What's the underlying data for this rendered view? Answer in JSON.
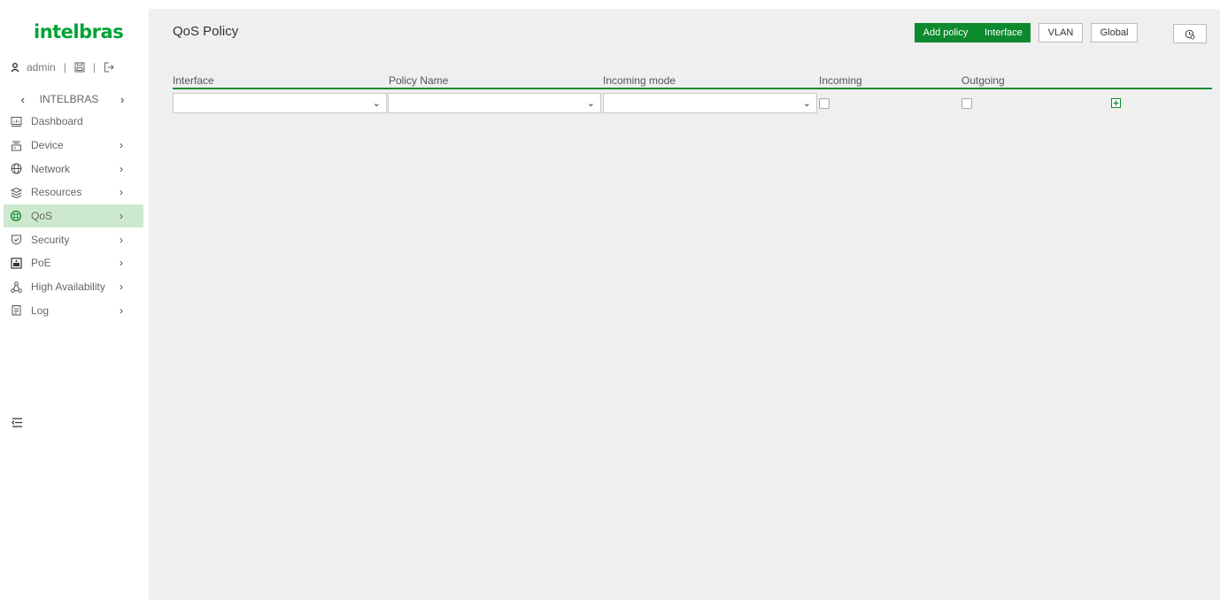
{
  "sidebar": {
    "logo": "intelbras",
    "user": "admin",
    "device_name": "INTELBRAS",
    "items": [
      {
        "label": "Dashboard",
        "icon": "dashboard-icon",
        "has_arrow": false
      },
      {
        "label": "Device",
        "icon": "device-icon",
        "has_arrow": true
      },
      {
        "label": "Network",
        "icon": "globe-icon",
        "has_arrow": true
      },
      {
        "label": "Resources",
        "icon": "layers-icon",
        "has_arrow": true
      },
      {
        "label": "QoS",
        "icon": "qos-icon",
        "has_arrow": true,
        "active": true
      },
      {
        "label": "Security",
        "icon": "shield-icon",
        "has_arrow": true
      },
      {
        "label": "PoE",
        "icon": "poe-icon",
        "has_arrow": true
      },
      {
        "label": "High Availability",
        "icon": "nodes-icon",
        "has_arrow": true
      },
      {
        "label": "Log",
        "icon": "log-icon",
        "has_arrow": true
      }
    ]
  },
  "header": {
    "title": "QoS Policy",
    "buttons": {
      "add_policy": "Add policy",
      "interface": "Interface",
      "vlan": "VLAN",
      "global": "Global"
    }
  },
  "table": {
    "columns": [
      "Interface",
      "Policy Name",
      "Incoming mode",
      "Incoming",
      "Outgoing"
    ],
    "row": {
      "interface_value": "",
      "policy_name_value": "",
      "incoming_mode_value": "",
      "incoming_checked": false,
      "outgoing_checked": false
    }
  },
  "colors": {
    "accent": "#0e8a2e",
    "brand": "#00a335",
    "active_bg": "#cde9cd",
    "content_bg": "#efefef"
  }
}
